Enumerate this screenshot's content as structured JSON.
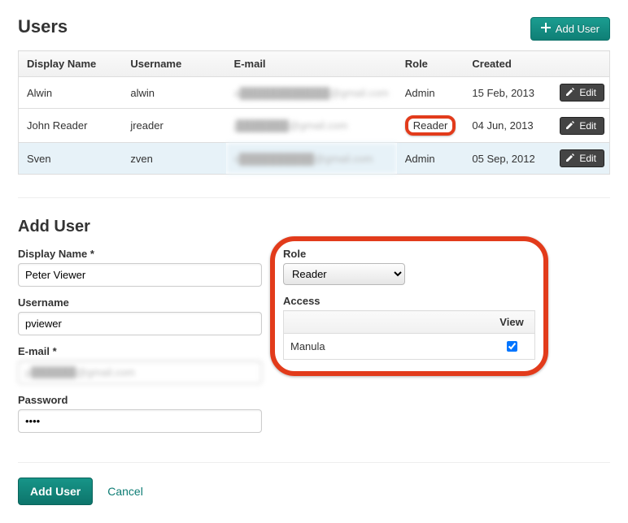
{
  "header": {
    "title": "Users",
    "add_user_label": "Add User"
  },
  "table": {
    "columns": {
      "display_name": "Display Name",
      "username": "Username",
      "email": "E-mail",
      "role": "Role",
      "created": "Created"
    },
    "edit_label": "Edit",
    "rows": [
      {
        "display_name": "Alwin",
        "username": "alwin",
        "email": "a████████████@gmail.com",
        "role": "Admin",
        "created": "15 Feb, 2013"
      },
      {
        "display_name": "John Reader",
        "username": "jreader",
        "email": "j███████@gmail.com",
        "role": "Reader",
        "created": "04 Jun, 2013"
      },
      {
        "display_name": "Sven",
        "username": "zven",
        "email": "s██████████@gmail.com",
        "role": "Admin",
        "created": "05 Sep, 2012"
      }
    ]
  },
  "form": {
    "title": "Add User",
    "labels": {
      "display_name": "Display Name *",
      "username": "Username",
      "email": "E-mail *",
      "password": "Password",
      "role": "Role",
      "access": "Access",
      "view_col": "View"
    },
    "values": {
      "display_name": "Peter Viewer",
      "username": "pviewer",
      "email": "p██████@gmail.com",
      "password": "••••",
      "role_selected": "Reader"
    },
    "access_rows": [
      {
        "name": "Manula",
        "view": true
      }
    ],
    "submit_label": "Add User",
    "cancel_label": "Cancel"
  }
}
